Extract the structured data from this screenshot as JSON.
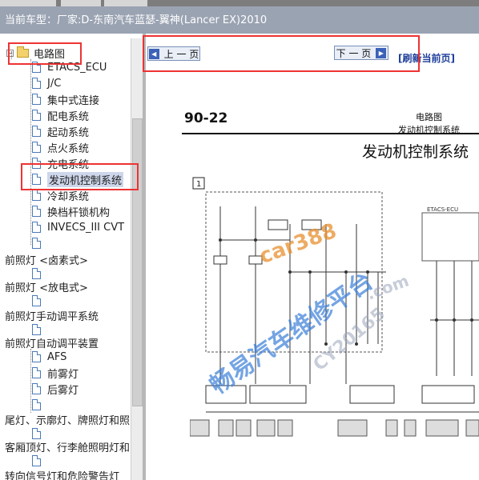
{
  "header": {
    "vehicle_label": "当前车型：",
    "vehicle_value": "厂家:D-东南汽车蓝瑟-翼神(Lancer EX)2010"
  },
  "tree": {
    "root": {
      "label": "电路图",
      "toggle": "−"
    },
    "children": [
      "ETACS_ECU",
      "J/C",
      "集中式连接",
      "配电系统",
      "起动系统",
      "点火系统",
      "充电系统",
      "发动机控制系统",
      "冷却系统",
      "换档杆锁机构",
      "INVECS_III CVT"
    ],
    "groups": [
      {
        "label": "前照灯 <卤素式>"
      },
      {
        "label": "前照灯 <放电式>"
      },
      {
        "label": "前照灯手动调平系统"
      },
      {
        "label": "前照灯自动调平装置",
        "children": [
          "AFS",
          "前雾灯",
          "后雾灯"
        ]
      },
      {
        "label": "尾灯、示廓灯、牌照灯和照"
      },
      {
        "label": "客厢顶灯、行李舱照明灯和"
      },
      {
        "label": "转向信号灯和危险警告灯"
      }
    ]
  },
  "nav": {
    "prev_label": "上 一 页",
    "next_label": "下 一 页",
    "refresh_label": "[刷新当前页]"
  },
  "document": {
    "page_number": "90-22",
    "section": "电路图",
    "subsection": "发动机控制系统",
    "title": "发动机控制系统",
    "box_number": "1",
    "ecu_label": "ETACS-ECU"
  },
  "watermark": {
    "text1": "car388",
    "text2": "畅易汽车维修平台",
    "text3": "CY20165",
    "text4": ".com"
  },
  "colors": {
    "accent": "#3b62b7",
    "highlight": "#e33333",
    "titlebar": "#9aa3b2",
    "watermark_blue": "#3a7ed8",
    "watermark_orange": "#e89030"
  }
}
